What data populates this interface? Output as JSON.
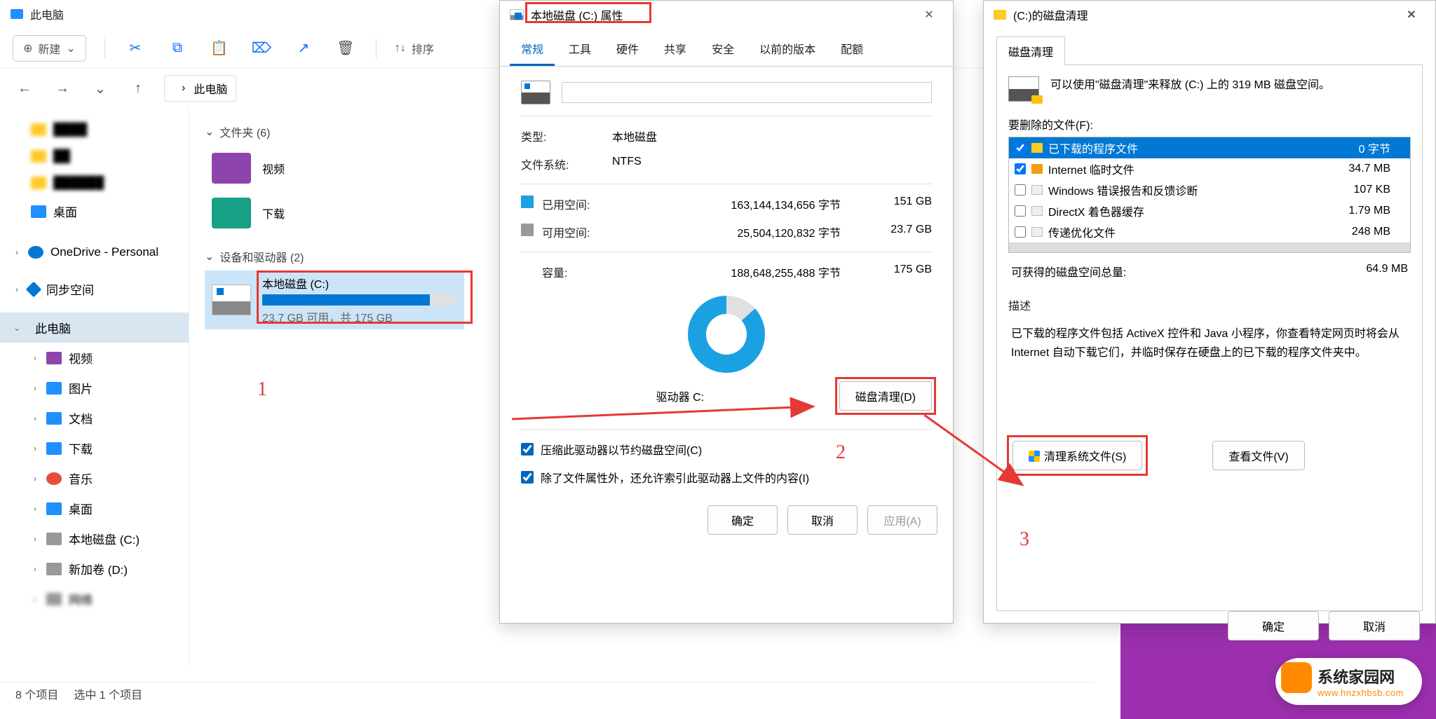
{
  "explorer": {
    "title": "此电脑",
    "new_btn": "新建",
    "sort_btn": "排序",
    "breadcrumb": "此电脑",
    "side": {
      "desktop": "桌面",
      "onedrive": "OneDrive - Personal",
      "sync": "同步空间",
      "thispc": "此电脑",
      "video": "视频",
      "pictures": "图片",
      "docs": "文档",
      "downloads": "下载",
      "music": "音乐",
      "desk2": "桌面",
      "cdrive": "本地磁盘 (C:)",
      "ddrive": "新加卷 (D:)",
      "net": "网络"
    },
    "groups": {
      "folders": "文件夹  (6)",
      "drives": "设备和驱动器  (2)"
    },
    "tiles": {
      "video": "视频",
      "download": "下载"
    },
    "drive": {
      "name": "本地磁盘 (C:)",
      "sub": "23.7 GB 可用，共 175 GB",
      "fill_pct": 86
    },
    "status": {
      "items": "8 个项目",
      "sel": "选中 1 个项目"
    }
  },
  "annotate": {
    "n1": "1",
    "n2": "2",
    "n3": "3"
  },
  "props": {
    "title": "本地磁盘 (C:) 属性",
    "tabs": [
      "常规",
      "工具",
      "硬件",
      "共享",
      "安全",
      "以前的版本",
      "配额"
    ],
    "type_k": "类型:",
    "type_v": "本地磁盘",
    "fs_k": "文件系统:",
    "fs_v": "NTFS",
    "used_k": "已用空间:",
    "used_b": "163,144,134,656 字节",
    "used_g": "151 GB",
    "free_k": "可用空间:",
    "free_b": "25,504,120,832 字节",
    "free_g": "23.7 GB",
    "cap_k": "容量:",
    "cap_b": "188,648,255,488 字节",
    "cap_g": "175 GB",
    "drv_label": "驱动器 C:",
    "cleanup_btn": "磁盘清理(D)",
    "chk1": "压缩此驱动器以节约磁盘空间(C)",
    "chk2": "除了文件属性外，还允许索引此驱动器上文件的内容(I)",
    "ok": "确定",
    "cancel": "取消",
    "apply": "应用(A)"
  },
  "clean": {
    "title": "(C:)的磁盘清理",
    "tab": "磁盘清理",
    "intro": "可以使用\"磁盘清理\"来释放  (C:) 上的 319 MB 磁盘空间。",
    "files_label": "要删除的文件(F):",
    "rows": [
      {
        "name": "已下载的程序文件",
        "size": "0 字节",
        "checked": true,
        "sel": true
      },
      {
        "name": "Internet 临时文件",
        "size": "34.7 MB",
        "checked": true
      },
      {
        "name": "Windows 错误报告和反馈诊断",
        "size": "107 KB",
        "checked": false
      },
      {
        "name": "DirectX 着色器缓存",
        "size": "1.79 MB",
        "checked": false
      },
      {
        "name": "传递优化文件",
        "size": "248 MB",
        "checked": false
      }
    ],
    "gain_k": "可获得的磁盘空间总量:",
    "gain_v": "64.9 MB",
    "desc_title": "描述",
    "desc_body": "已下载的程序文件包括 ActiveX 控件和 Java 小程序，你查看特定网页时将会从 Internet 自动下载它们，并临时保存在硬盘上的已下载的程序文件夹中。",
    "sysclean": "清理系统文件(S)",
    "viewfiles": "查看文件(V)",
    "ok": "确定",
    "cancel": "取消"
  },
  "watermark": {
    "t1": "系统家园网",
    "t2": "www.hnzxhbsb.com"
  }
}
